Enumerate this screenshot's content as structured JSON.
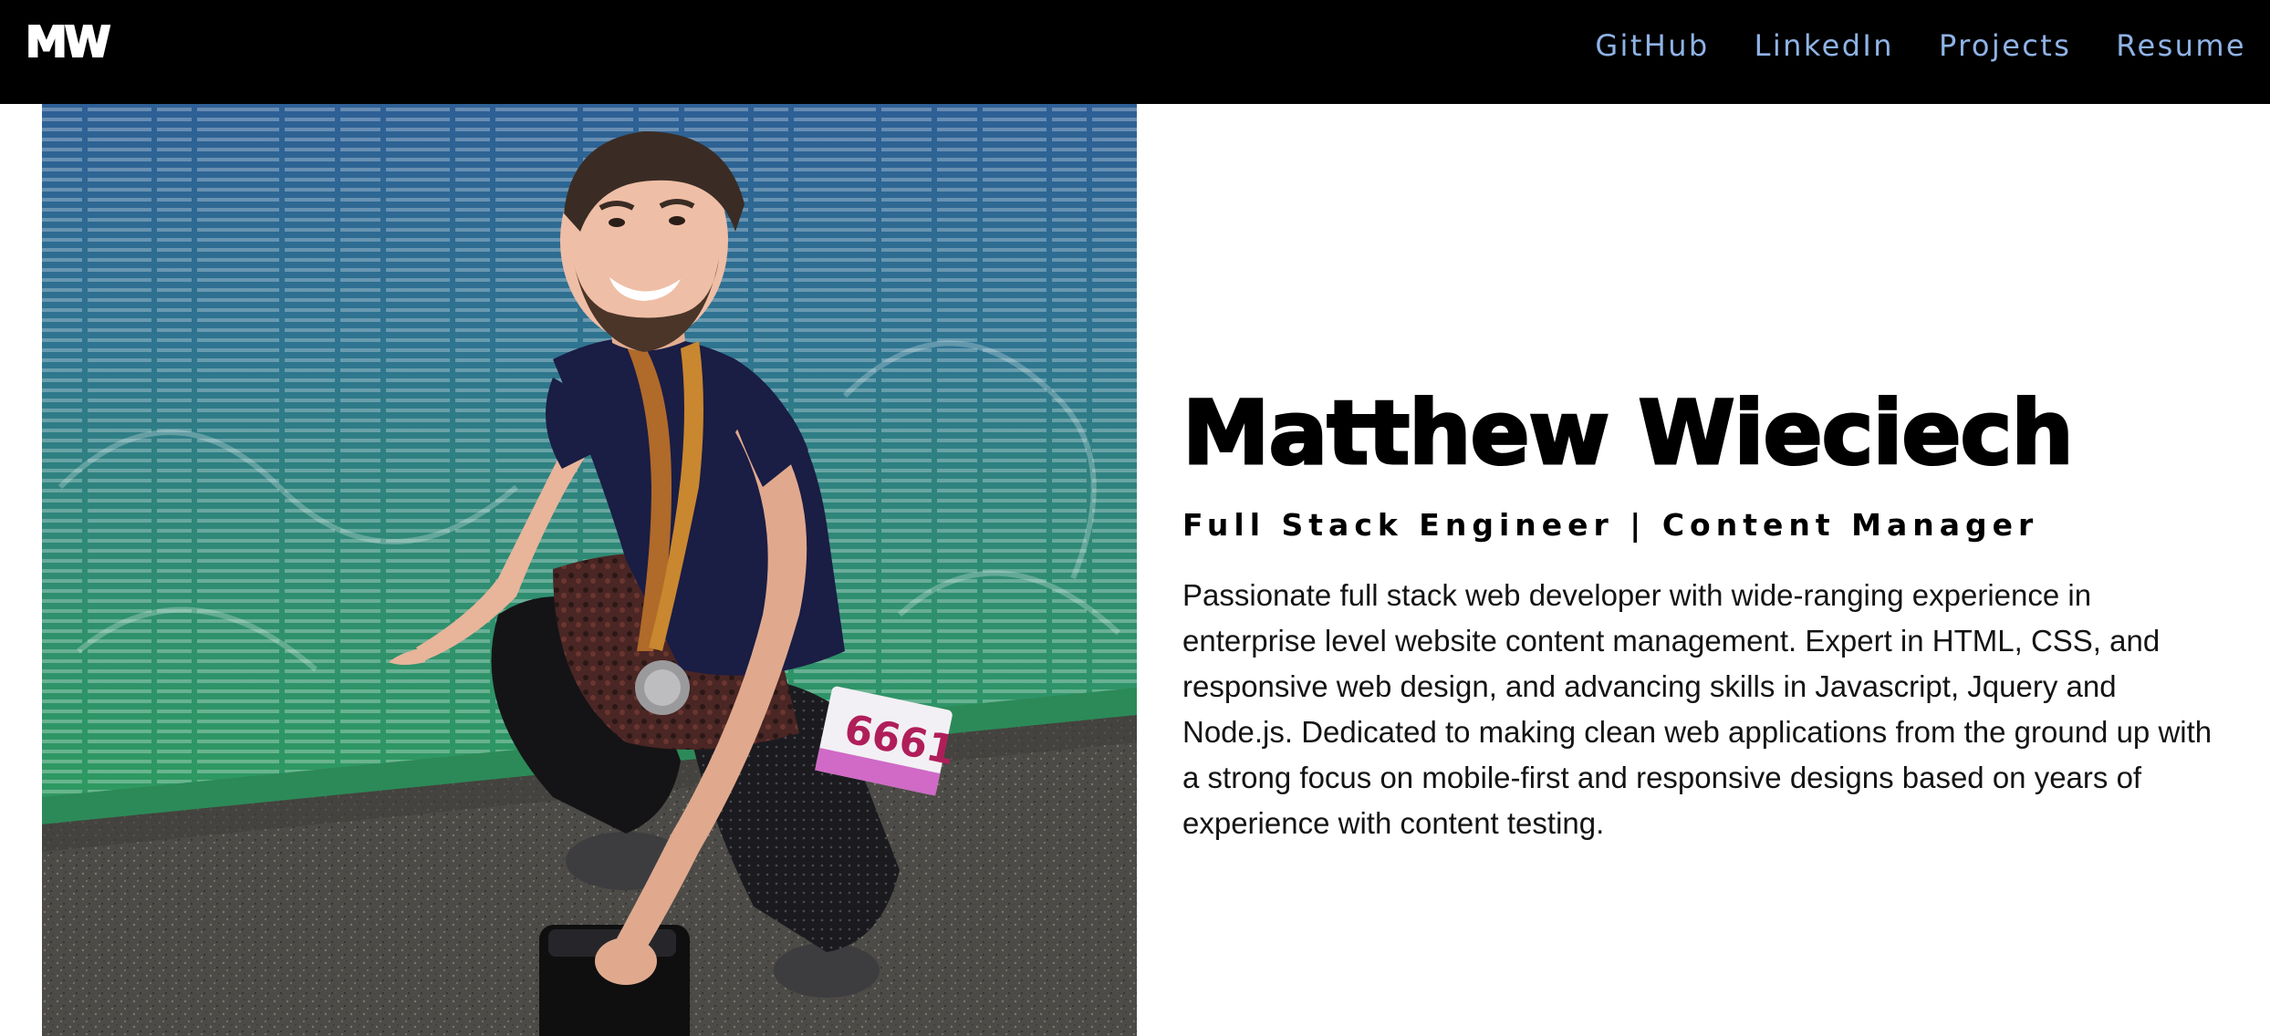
{
  "header": {
    "logo": "MW",
    "nav": [
      "GitHub",
      "LinkedIn",
      "Projects",
      "Resume"
    ]
  },
  "intro": {
    "name": "Matthew Wieciech",
    "subtitle": "Full Stack Engineer | Content Manager",
    "bio": "Passionate full stack web developer with wide-ranging experience in enterprise level website content management. Expert in HTML, CSS, and responsive web design, and advancing skills in Javascript, Jquery and Node.js. Dedicated to making clean web applications from the ground up with a strong focus on mobile-first and responsive designs based on years of experience with content testing."
  },
  "photo": {
    "bib_number": "6661"
  },
  "colors": {
    "header_bg": "#000000",
    "nav_link": "#8fb3e6",
    "text": "#000000",
    "page_bg": "#ffffff"
  }
}
